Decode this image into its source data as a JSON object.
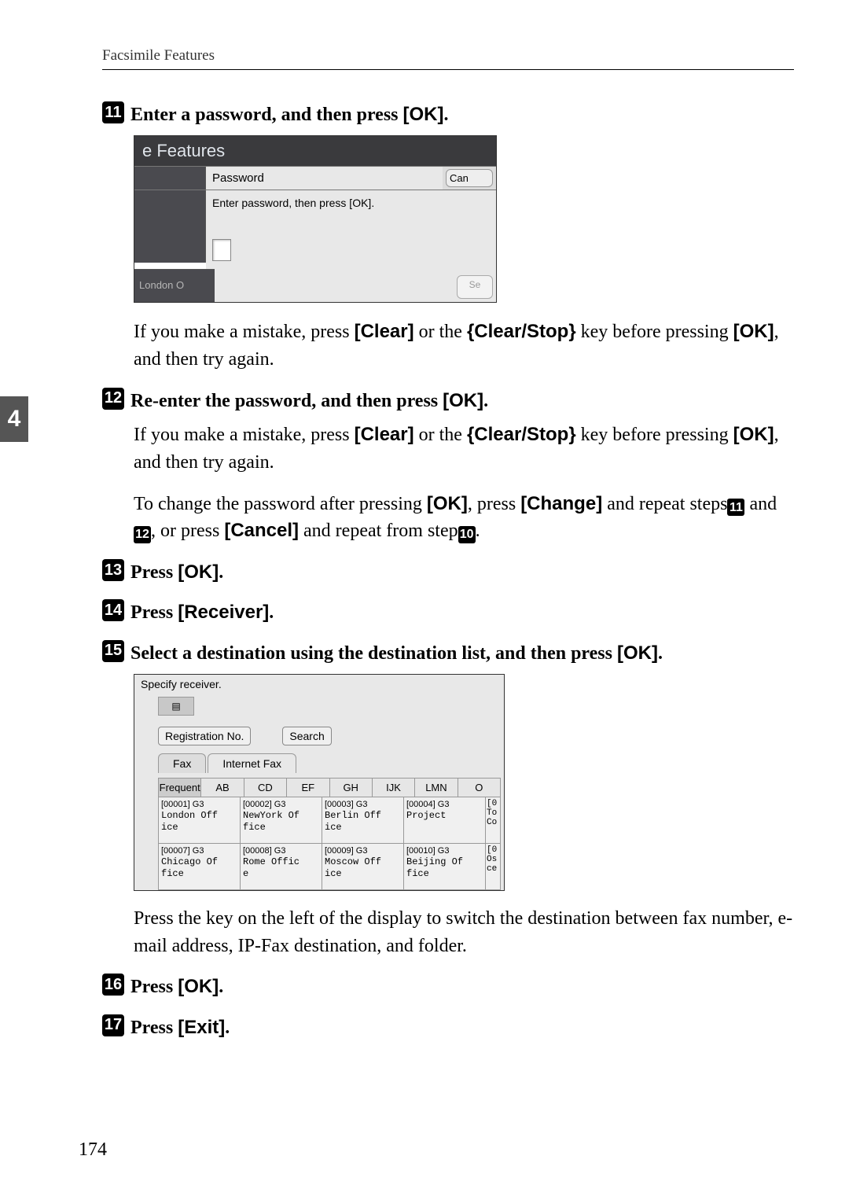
{
  "header": {
    "section": "Facsimile Features"
  },
  "sideTab": "4",
  "pageNumber": "174",
  "steps": {
    "s11": {
      "num": "11",
      "title_a": "Enter a password, and then press ",
      "title_b": "[OK]",
      "title_c": "."
    },
    "s12": {
      "num": "12",
      "title_a": "Re-enter the password, and then press ",
      "title_b": "[OK]",
      "title_c": "."
    },
    "s13": {
      "num": "13",
      "title_a": "Press ",
      "title_b": "[OK]",
      "title_c": "."
    },
    "s14": {
      "num": "14",
      "title_a": "Press ",
      "title_b": "[Receiver]",
      "title_c": "."
    },
    "s15": {
      "num": "15",
      "title_a": "Select a destination using the destination list, and then press ",
      "title_b": "[OK]",
      "title_c": "."
    },
    "s16": {
      "num": "16",
      "title_a": "Press ",
      "title_b": "[OK]",
      "title_c": "."
    },
    "s17": {
      "num": "17",
      "title_a": "Press ",
      "title_b": "[Exit]",
      "title_c": "."
    }
  },
  "para1": {
    "a": "If you make a mistake, press ",
    "b": "[Clear]",
    "c": " or the ",
    "d": "{",
    "e": "Clear/Stop",
    "f": "}",
    "g": " key before pressing ",
    "h": "[OK]",
    "i": ", and then try again."
  },
  "para3": {
    "a": "To change the password after pressing ",
    "b": "[OK]",
    "c": ", press ",
    "d": "[Change]",
    "e": " and repeat steps",
    "ref11": "11",
    "f": " and ",
    "ref12": "12",
    "g": ", or press ",
    "h": "[Cancel]",
    "i": " and repeat from step",
    "ref10": "10",
    "j": "."
  },
  "para4": "Press the key on the left of the display to switch the destination between fax number, e-mail address, IP-Fax destination, and folder.",
  "ss1": {
    "titlebar": "e Features",
    "label": "Password",
    "cancel": "Can",
    "prompt": "Enter password, then press [OK].",
    "london": "London O",
    "se": "Se"
  },
  "ss2": {
    "title": "Specify receiver.",
    "reg": "Registration No.",
    "search": "Search",
    "modeFax": "Fax",
    "modeIFax": "Internet Fax",
    "alpha": [
      "Frequent",
      "AB",
      "CD",
      "EF",
      "GH",
      "IJK",
      "LMN",
      "O"
    ],
    "row1": [
      {
        "code": "[00001] G3",
        "name": "London Off\nice"
      },
      {
        "code": "[00002] G3",
        "name": "NewYork Of\nfice"
      },
      {
        "code": "[00003] G3",
        "name": "Berlin Off\nice"
      },
      {
        "code": "[00004] G3",
        "name": "Project"
      }
    ],
    "row1partial": "[0\nTo\nCo",
    "row2": [
      {
        "code": "[00007] G3",
        "name": "Chicago Of\nfice"
      },
      {
        "code": "[00008] G3",
        "name": "Rome Offic\ne"
      },
      {
        "code": "[00009] G3",
        "name": "Moscow Off\nice"
      },
      {
        "code": "[00010] G3",
        "name": "Beijing Of\nfice"
      }
    ],
    "row2partial": "[0\nOs\nce"
  }
}
